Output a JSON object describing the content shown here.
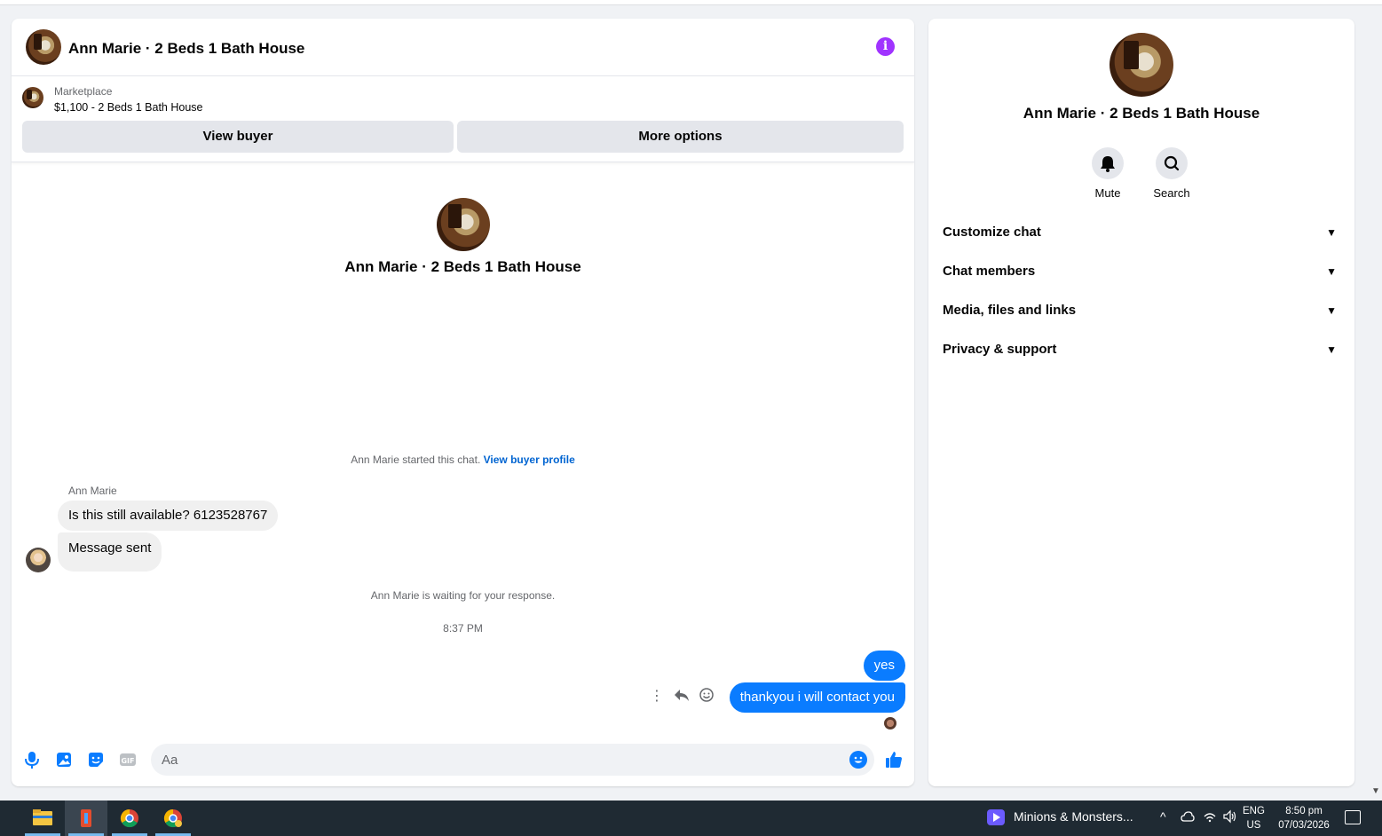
{
  "chat": {
    "header_title": "Ann Marie · 2 Beds 1 Bath House",
    "listing": {
      "source": "Marketplace",
      "title": "$1,100 - 2 Beds 1 Bath House",
      "view_buyer": "View buyer",
      "more_options": "More options"
    },
    "intro_name": "Ann Marie · 2 Beds 1 Bath House",
    "started_text": "Ann Marie started this chat.",
    "started_link": "View buyer profile",
    "sender_name": "Ann Marie",
    "incoming": [
      "Is this still available? 6123528767",
      "Message sent"
    ],
    "waiting_text": "Ann Marie is waiting for your response.",
    "timestamp": "8:37 PM",
    "outgoing": [
      "yes",
      "thankyou i  will contact you"
    ],
    "composer_placeholder": "Aa"
  },
  "side": {
    "name": "Ann Marie · 2 Beds 1 Bath House",
    "actions": {
      "mute": "Mute",
      "search": "Search"
    },
    "sections": [
      "Customize chat",
      "Chat members",
      "Media, files and links",
      "Privacy & support"
    ]
  },
  "taskbar": {
    "media_title": "Minions & Monsters...",
    "lang_top": "ENG",
    "lang_bottom": "US",
    "time": "8:50 pm",
    "date": "07/03/2026"
  },
  "colors": {
    "accent": "#0a7cff",
    "info": "#a033ff",
    "taskbar": "#1f2a33"
  }
}
